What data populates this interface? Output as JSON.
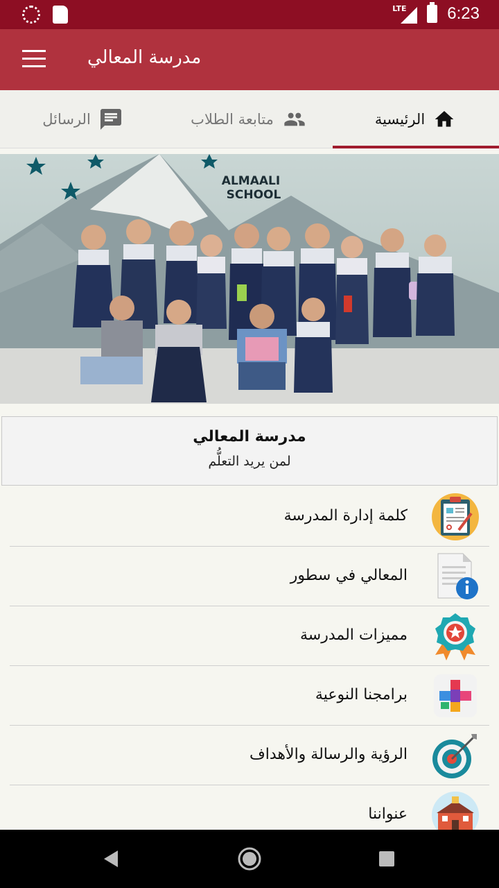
{
  "status_bar": {
    "network_label": "LTE",
    "time": "6:23"
  },
  "app_bar": {
    "title": "مدرسة المعالي"
  },
  "tabs": [
    {
      "label": "الرئيسية",
      "icon": "home-icon",
      "active": true
    },
    {
      "label": "متابعة الطلاب",
      "icon": "people-icon",
      "active": false
    },
    {
      "label": "الرسائل",
      "icon": "message-icon",
      "active": false
    }
  ],
  "hero": {
    "sign_line1": "ALMAALI",
    "sign_line2": "SCHOOL"
  },
  "info_card": {
    "title": "مدرسة المعالي",
    "subtitle": "لمن يريد التعلُّم"
  },
  "menu": [
    {
      "label": "كلمة إدارة المدرسة",
      "icon": "clipboard-icon"
    },
    {
      "label": "المعالي في سطور",
      "icon": "document-info-icon"
    },
    {
      "label": "مميزات المدرسة",
      "icon": "badge-star-icon"
    },
    {
      "label": "برامجنا النوعية",
      "icon": "colorful-plus-icon"
    },
    {
      "label": "الرؤية والرسالة والأهداف",
      "icon": "target-icon"
    },
    {
      "label": "عنواننا",
      "icon": "school-building-icon"
    }
  ],
  "colors": {
    "status_bar": "#8d0e23",
    "app_bar": "#b0323e",
    "tab_indicator": "#a01c2e"
  }
}
